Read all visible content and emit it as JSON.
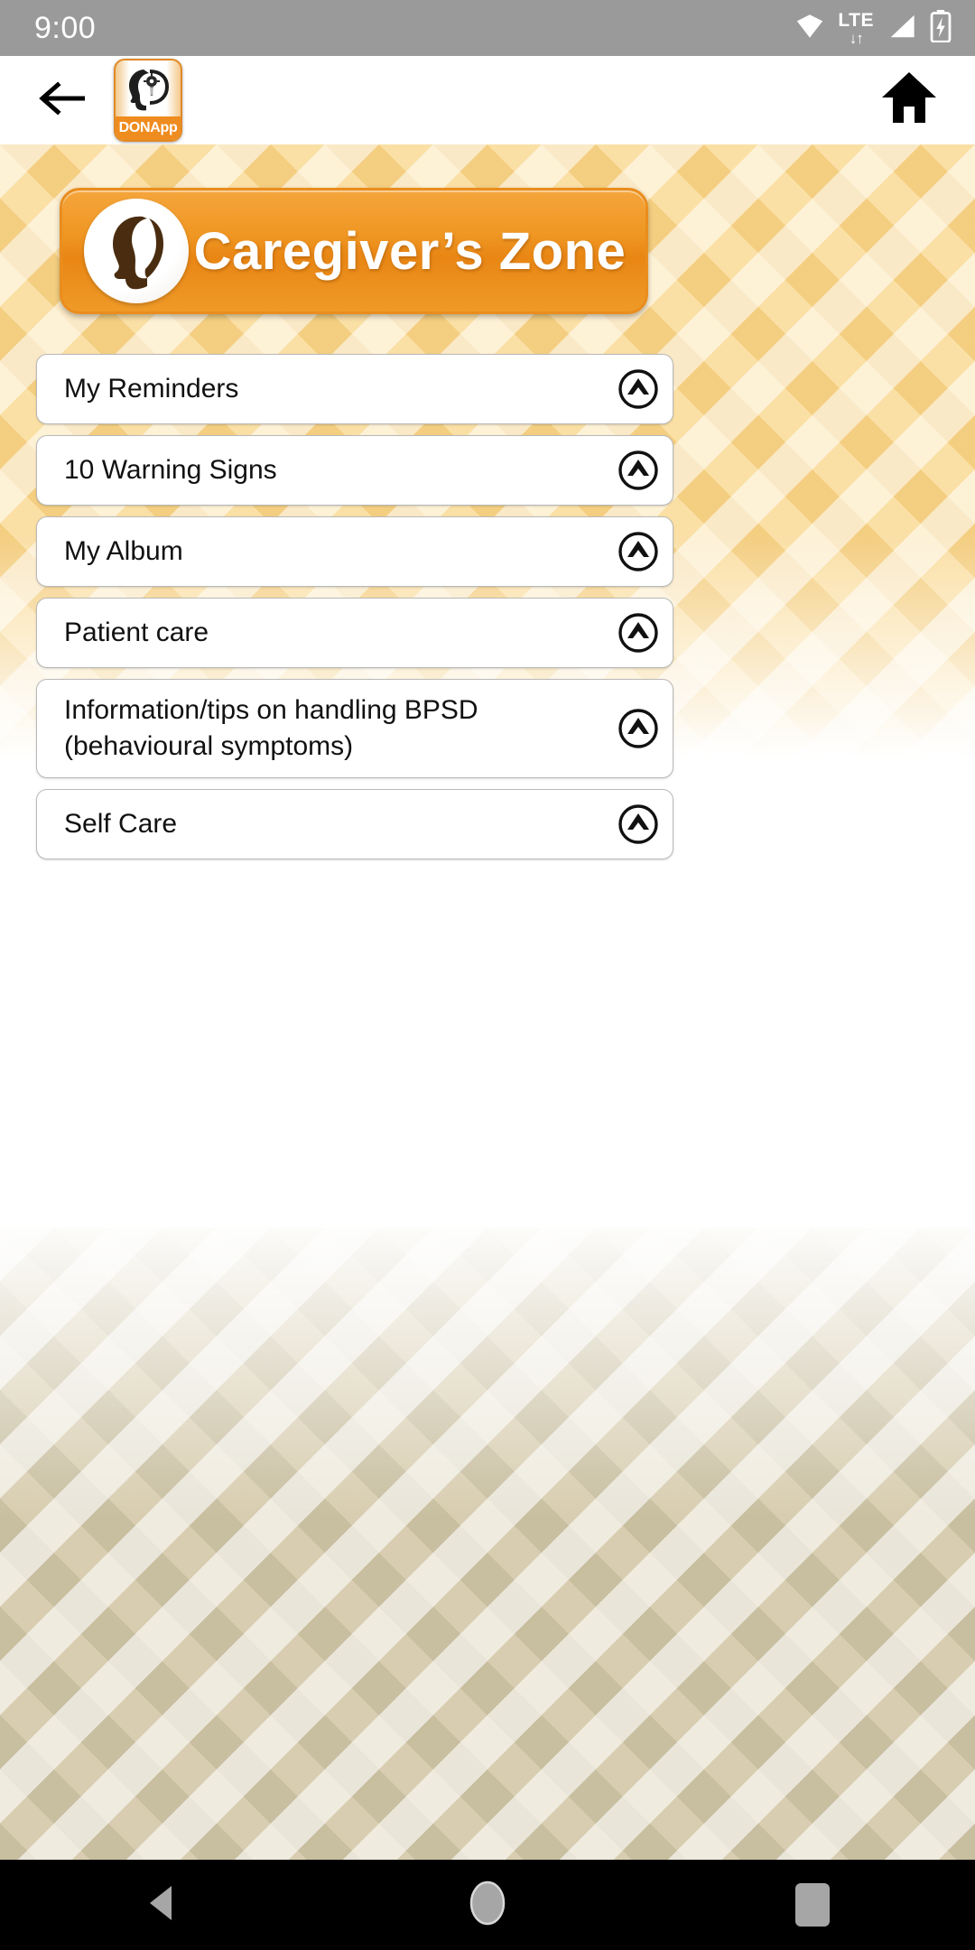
{
  "status_bar": {
    "time": "9:00",
    "wifi_icon": "wifi-icon",
    "network_label": "LTE",
    "data_arrows": "↓↑",
    "signal_icon": "signal-icon",
    "battery_icon": "battery-charging-icon"
  },
  "app_bar": {
    "back_icon": "back-arrow-icon",
    "logo": {
      "icon": "head-profile-gear-icon",
      "caption": "DONApp"
    },
    "home_icon": "home-icon"
  },
  "banner": {
    "title": "Caregiver’s Zone",
    "badge_icon": "head-silhouette-icon",
    "accent_color": "#ef9622",
    "border_color": "#e98d1e",
    "text_color": "#ffffff"
  },
  "menu": {
    "expand_icon": "circle-chevron-up-icon",
    "items": [
      {
        "label": "My Reminders"
      },
      {
        "label": "10 Warning Signs"
      },
      {
        "label": "My Album"
      },
      {
        "label": "Patient care"
      },
      {
        "label": "Information/tips on handling BPSD (behavioural symptoms)"
      },
      {
        "label": "Self Care"
      }
    ]
  },
  "nav_bar": {
    "back_icon": "nav-back-triangle-icon",
    "home_icon": "nav-home-circle-icon",
    "recents_icon": "nav-recents-square-icon"
  },
  "colors": {
    "status_bar_bg": "#9a9a9a",
    "app_bar_bg": "#ffffff",
    "pattern_bg": "#f6e2b4",
    "nav_bar_bg": "#000000",
    "card_bg": "#ffffff",
    "card_border": "#b9b9b9"
  }
}
